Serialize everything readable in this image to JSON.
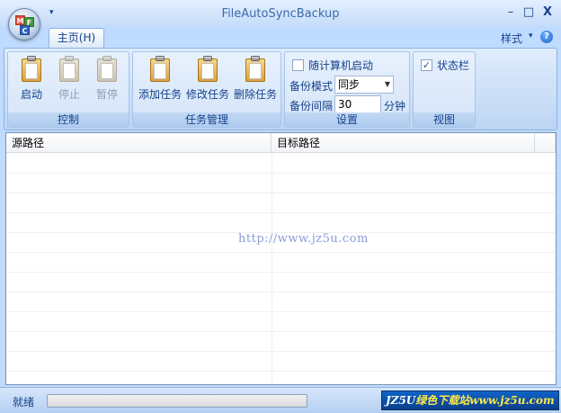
{
  "window": {
    "title": "FileAutoSyncBackup",
    "qat_arrow": "▾",
    "minimize": "–",
    "restore": "□",
    "close": "X"
  },
  "ribbon": {
    "tab_home": "主页(H)",
    "style_menu": "样式",
    "style_arrow": "▾",
    "help": "?",
    "groups": {
      "control": {
        "caption": "控制",
        "start": "启动",
        "stop": "停止",
        "pause": "暂停"
      },
      "tasks": {
        "caption": "任务管理",
        "add": "添加任务",
        "edit": "修改任务",
        "delete": "删除任务"
      },
      "settings": {
        "caption": "设置",
        "autostart_label": "随计算机启动",
        "autostart_checked": false,
        "mode_label": "备份模式",
        "mode_value": "同步",
        "interval_label": "备份间隔",
        "interval_value": "30",
        "interval_unit": "分钟"
      },
      "view": {
        "caption": "视图",
        "statusbar_label": "状态栏",
        "statusbar_checked": true,
        "check_mark": "✓"
      }
    }
  },
  "list": {
    "columns": [
      "源路径",
      "目标路径"
    ],
    "watermark": "http://www.jz5u.com"
  },
  "status": {
    "text": "就绪",
    "progress": 0,
    "brand_a": "JZ5U",
    "brand_b": "绿色下载站",
    "brand_c": "www.jz5u.com"
  },
  "colors": {
    "ribbon_text": "#15428b",
    "ribbon_bg": "#bfdbff",
    "badge_bg": "#0f64c8"
  },
  "icons": {
    "start": "clipboard-icon",
    "stop": "clipboard-icon",
    "pause": "clipboard-icon",
    "add": "clipboard-icon",
    "edit": "clipboard-icon",
    "delete": "clipboard-icon"
  }
}
